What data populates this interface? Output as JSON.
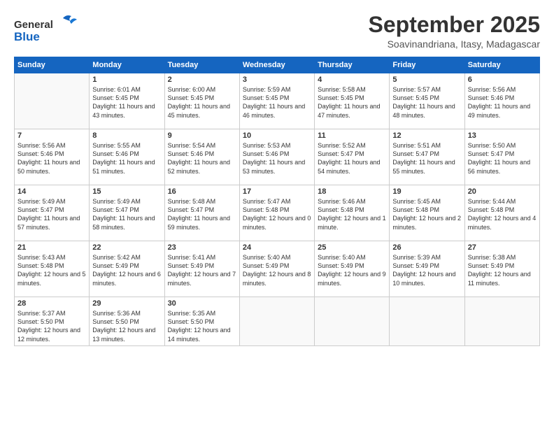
{
  "logo": {
    "line1": "General",
    "line2": "Blue"
  },
  "header": {
    "month": "September 2025",
    "location": "Soavinandriana, Itasy, Madagascar"
  },
  "weekdays": [
    "Sunday",
    "Monday",
    "Tuesday",
    "Wednesday",
    "Thursday",
    "Friday",
    "Saturday"
  ],
  "weeks": [
    [
      {
        "day": "",
        "sunrise": "",
        "sunset": "",
        "daylight": ""
      },
      {
        "day": "1",
        "sunrise": "Sunrise: 6:01 AM",
        "sunset": "Sunset: 5:45 PM",
        "daylight": "Daylight: 11 hours and 43 minutes."
      },
      {
        "day": "2",
        "sunrise": "Sunrise: 6:00 AM",
        "sunset": "Sunset: 5:45 PM",
        "daylight": "Daylight: 11 hours and 45 minutes."
      },
      {
        "day": "3",
        "sunrise": "Sunrise: 5:59 AM",
        "sunset": "Sunset: 5:45 PM",
        "daylight": "Daylight: 11 hours and 46 minutes."
      },
      {
        "day": "4",
        "sunrise": "Sunrise: 5:58 AM",
        "sunset": "Sunset: 5:45 PM",
        "daylight": "Daylight: 11 hours and 47 minutes."
      },
      {
        "day": "5",
        "sunrise": "Sunrise: 5:57 AM",
        "sunset": "Sunset: 5:45 PM",
        "daylight": "Daylight: 11 hours and 48 minutes."
      },
      {
        "day": "6",
        "sunrise": "Sunrise: 5:56 AM",
        "sunset": "Sunset: 5:46 PM",
        "daylight": "Daylight: 11 hours and 49 minutes."
      }
    ],
    [
      {
        "day": "7",
        "sunrise": "Sunrise: 5:56 AM",
        "sunset": "Sunset: 5:46 PM",
        "daylight": "Daylight: 11 hours and 50 minutes."
      },
      {
        "day": "8",
        "sunrise": "Sunrise: 5:55 AM",
        "sunset": "Sunset: 5:46 PM",
        "daylight": "Daylight: 11 hours and 51 minutes."
      },
      {
        "day": "9",
        "sunrise": "Sunrise: 5:54 AM",
        "sunset": "Sunset: 5:46 PM",
        "daylight": "Daylight: 11 hours and 52 minutes."
      },
      {
        "day": "10",
        "sunrise": "Sunrise: 5:53 AM",
        "sunset": "Sunset: 5:46 PM",
        "daylight": "Daylight: 11 hours and 53 minutes."
      },
      {
        "day": "11",
        "sunrise": "Sunrise: 5:52 AM",
        "sunset": "Sunset: 5:47 PM",
        "daylight": "Daylight: 11 hours and 54 minutes."
      },
      {
        "day": "12",
        "sunrise": "Sunrise: 5:51 AM",
        "sunset": "Sunset: 5:47 PM",
        "daylight": "Daylight: 11 hours and 55 minutes."
      },
      {
        "day": "13",
        "sunrise": "Sunrise: 5:50 AM",
        "sunset": "Sunset: 5:47 PM",
        "daylight": "Daylight: 11 hours and 56 minutes."
      }
    ],
    [
      {
        "day": "14",
        "sunrise": "Sunrise: 5:49 AM",
        "sunset": "Sunset: 5:47 PM",
        "daylight": "Daylight: 11 hours and 57 minutes."
      },
      {
        "day": "15",
        "sunrise": "Sunrise: 5:49 AM",
        "sunset": "Sunset: 5:47 PM",
        "daylight": "Daylight: 11 hours and 58 minutes."
      },
      {
        "day": "16",
        "sunrise": "Sunrise: 5:48 AM",
        "sunset": "Sunset: 5:47 PM",
        "daylight": "Daylight: 11 hours and 59 minutes."
      },
      {
        "day": "17",
        "sunrise": "Sunrise: 5:47 AM",
        "sunset": "Sunset: 5:48 PM",
        "daylight": "Daylight: 12 hours and 0 minutes."
      },
      {
        "day": "18",
        "sunrise": "Sunrise: 5:46 AM",
        "sunset": "Sunset: 5:48 PM",
        "daylight": "Daylight: 12 hours and 1 minute."
      },
      {
        "day": "19",
        "sunrise": "Sunrise: 5:45 AM",
        "sunset": "Sunset: 5:48 PM",
        "daylight": "Daylight: 12 hours and 2 minutes."
      },
      {
        "day": "20",
        "sunrise": "Sunrise: 5:44 AM",
        "sunset": "Sunset: 5:48 PM",
        "daylight": "Daylight: 12 hours and 4 minutes."
      }
    ],
    [
      {
        "day": "21",
        "sunrise": "Sunrise: 5:43 AM",
        "sunset": "Sunset: 5:48 PM",
        "daylight": "Daylight: 12 hours and 5 minutes."
      },
      {
        "day": "22",
        "sunrise": "Sunrise: 5:42 AM",
        "sunset": "Sunset: 5:49 PM",
        "daylight": "Daylight: 12 hours and 6 minutes."
      },
      {
        "day": "23",
        "sunrise": "Sunrise: 5:41 AM",
        "sunset": "Sunset: 5:49 PM",
        "daylight": "Daylight: 12 hours and 7 minutes."
      },
      {
        "day": "24",
        "sunrise": "Sunrise: 5:40 AM",
        "sunset": "Sunset: 5:49 PM",
        "daylight": "Daylight: 12 hours and 8 minutes."
      },
      {
        "day": "25",
        "sunrise": "Sunrise: 5:40 AM",
        "sunset": "Sunset: 5:49 PM",
        "daylight": "Daylight: 12 hours and 9 minutes."
      },
      {
        "day": "26",
        "sunrise": "Sunrise: 5:39 AM",
        "sunset": "Sunset: 5:49 PM",
        "daylight": "Daylight: 12 hours and 10 minutes."
      },
      {
        "day": "27",
        "sunrise": "Sunrise: 5:38 AM",
        "sunset": "Sunset: 5:49 PM",
        "daylight": "Daylight: 12 hours and 11 minutes."
      }
    ],
    [
      {
        "day": "28",
        "sunrise": "Sunrise: 5:37 AM",
        "sunset": "Sunset: 5:50 PM",
        "daylight": "Daylight: 12 hours and 12 minutes."
      },
      {
        "day": "29",
        "sunrise": "Sunrise: 5:36 AM",
        "sunset": "Sunset: 5:50 PM",
        "daylight": "Daylight: 12 hours and 13 minutes."
      },
      {
        "day": "30",
        "sunrise": "Sunrise: 5:35 AM",
        "sunset": "Sunset: 5:50 PM",
        "daylight": "Daylight: 12 hours and 14 minutes."
      },
      {
        "day": "",
        "sunrise": "",
        "sunset": "",
        "daylight": ""
      },
      {
        "day": "",
        "sunrise": "",
        "sunset": "",
        "daylight": ""
      },
      {
        "day": "",
        "sunrise": "",
        "sunset": "",
        "daylight": ""
      },
      {
        "day": "",
        "sunrise": "",
        "sunset": "",
        "daylight": ""
      }
    ]
  ]
}
